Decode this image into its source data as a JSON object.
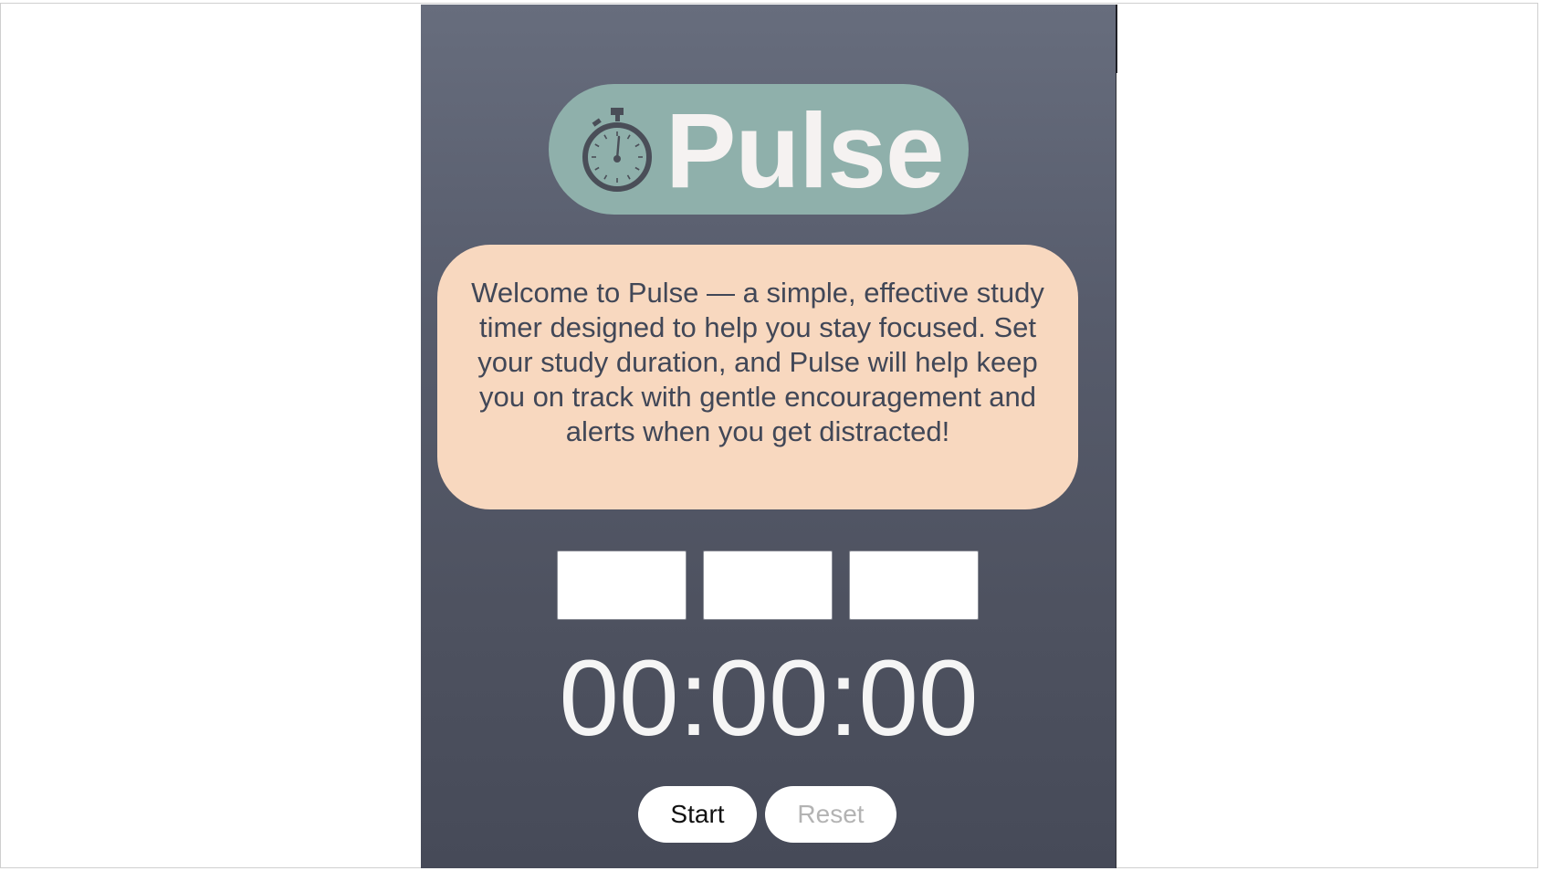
{
  "app": {
    "name": "Pulse",
    "logo_icon": "stopwatch-icon",
    "colors": {
      "background_top": "#676d7d",
      "background_bottom": "#464a58",
      "logo_pill": "#8fb0ab",
      "welcome_box": "#f8d8bf",
      "welcome_text": "#414757",
      "timer_text": "#f5f5f5"
    }
  },
  "welcome": {
    "text": "Welcome to Pulse — a simple, effective study timer designed to help you stay focused. Set your study duration, and Pulse will help keep you on track with gentle encouragement and alerts when you get distracted!"
  },
  "inputs": {
    "hours_value": "",
    "minutes_value": "",
    "seconds_value": ""
  },
  "timer": {
    "display": "00:00:00"
  },
  "controls": {
    "start_label": "Start",
    "reset_label": "Reset"
  }
}
